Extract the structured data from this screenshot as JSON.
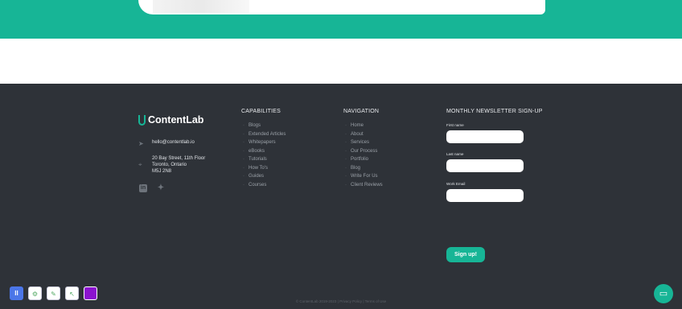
{
  "hero": {},
  "footer": {
    "logo_text": "ContentLab",
    "email": "hello@contentlab.io",
    "address_lines": [
      "20 Bay Street, 11th Floor",
      "Toronto, Ontario",
      "M5J 2N8"
    ],
    "capabilities": {
      "heading": "CAPABILITIES",
      "items": [
        "Blogs",
        "Extended Articles",
        "Whitepapers",
        "eBooks",
        "Tutorials",
        "How To's",
        "Guides",
        "Courses"
      ]
    },
    "navigation": {
      "heading": "NAVIGATION",
      "items": [
        "Home",
        "About",
        "Services",
        "Our Process",
        "Portfolio",
        "Blog",
        "Write For Us",
        "Client Reviews"
      ]
    },
    "newsletter": {
      "heading": "MONTHLY NEWSLETTER SIGN-UP",
      "first_name_label": "First name",
      "last_name_label": "Last name",
      "work_email_label": "Work Email",
      "signup_label": "Sign up!"
    },
    "copyright": "© ContentLab 2019-2023 | Privacy Policy | Terms of Use"
  },
  "colors": {
    "accent": "#17b596",
    "footer_bg": "#2e3238"
  },
  "toolbar": {
    "pause_label": "II"
  }
}
